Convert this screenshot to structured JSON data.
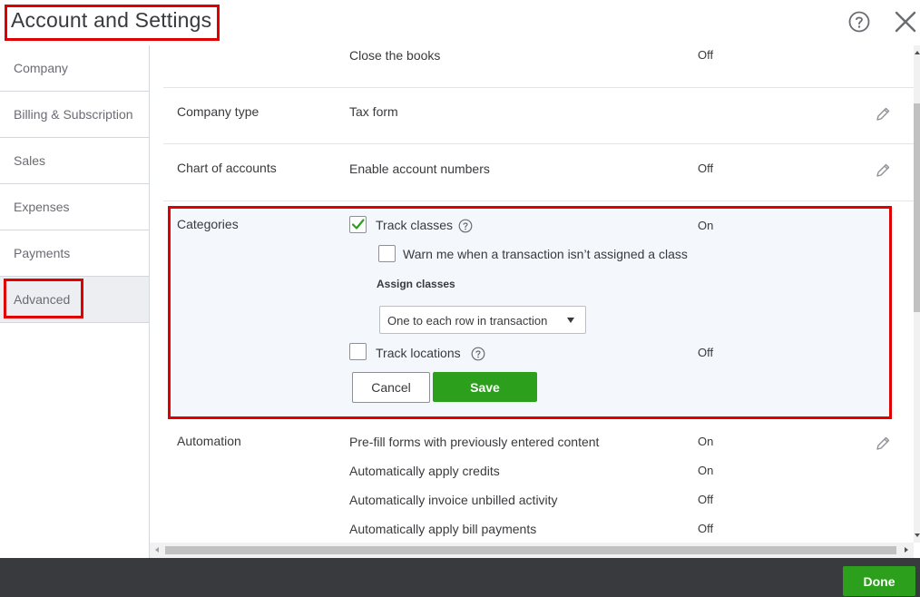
{
  "header": {
    "title": "Account and Settings",
    "help_icon": "question-circle-icon",
    "close_icon": "close-x-icon"
  },
  "sidebar": {
    "items": [
      {
        "label": "Company",
        "active": false
      },
      {
        "label": "Billing & Subscription",
        "active": false
      },
      {
        "label": "Sales",
        "active": false
      },
      {
        "label": "Expenses",
        "active": false
      },
      {
        "label": "Payments",
        "active": false
      },
      {
        "label": "Advanced",
        "active": true
      }
    ]
  },
  "main": {
    "accounting": {
      "setting": "Close the books",
      "status": "Off"
    },
    "company_type": {
      "label": "Company type",
      "setting": "Tax form"
    },
    "chart_of_accounts": {
      "label": "Chart of accounts",
      "setting": "Enable account numbers",
      "status": "Off"
    },
    "categories": {
      "label": "Categories",
      "track_classes": {
        "label": "Track classes",
        "checked": true,
        "status": "On"
      },
      "warn": {
        "label": "Warn me when a transaction isn’t assigned a class",
        "checked": false
      },
      "assign_classes_label": "Assign classes",
      "assign_classes_value": "One to each row in transaction",
      "track_locations": {
        "label": "Track locations",
        "checked": false,
        "status": "Off"
      },
      "cancel_label": "Cancel",
      "save_label": "Save"
    },
    "automation": {
      "label": "Automation",
      "items": [
        {
          "label": "Pre-fill forms with previously entered content",
          "status": "On"
        },
        {
          "label": "Automatically apply credits",
          "status": "On"
        },
        {
          "label": "Automatically invoice unbilled activity",
          "status": "Off"
        },
        {
          "label": "Automatically apply bill payments",
          "status": "Off"
        }
      ]
    }
  },
  "footer": {
    "done_label": "Done"
  },
  "colors": {
    "brand_green": "#2ca01c",
    "highlight_red": "#e00000",
    "footer_bg": "#393a3d",
    "panel_bg": "#f4f8fc"
  }
}
